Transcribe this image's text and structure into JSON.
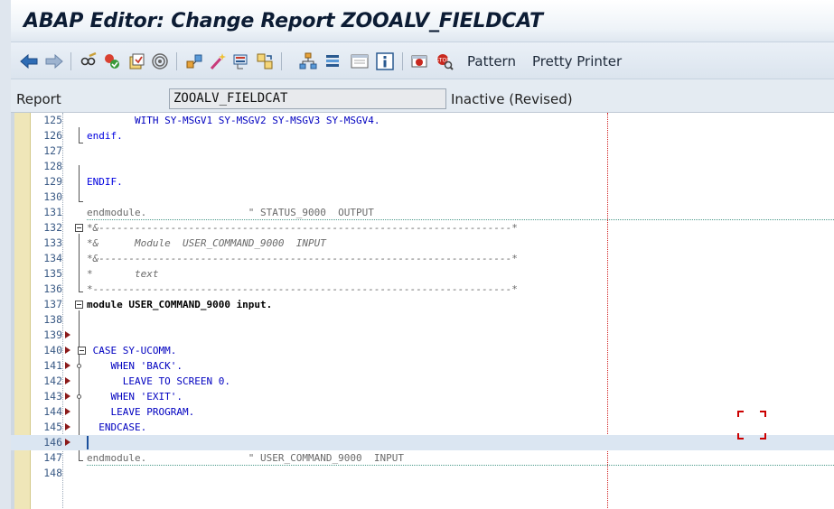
{
  "window": {
    "title": "ABAP Editor: Change Report ZOOALV_FIELDCAT"
  },
  "toolbar": {
    "icons": [
      {
        "name": "back-arrow-icon",
        "color": "#2f6db5"
      },
      {
        "name": "forward-arrow-icon",
        "color": "#8aa6c8"
      },
      {
        "name": "glasses-display-change-icon"
      },
      {
        "name": "activate-check-icon"
      },
      {
        "name": "test-object-icon"
      },
      {
        "name": "where-used-icon"
      },
      {
        "name": "object-list-icon"
      },
      {
        "name": "magic-wand-icon"
      },
      {
        "name": "debug-display-icon"
      },
      {
        "name": "sync-navigation-icon"
      },
      {
        "name": "hierarchy-icon"
      },
      {
        "name": "stack-icon"
      },
      {
        "name": "window-icon"
      },
      {
        "name": "info-icon"
      },
      {
        "name": "breakpoint-session-icon"
      },
      {
        "name": "breakpoint-external-icon"
      }
    ],
    "pattern_label": "Pattern",
    "pretty_printer_label": "Pretty Printer"
  },
  "report": {
    "label": "Report",
    "name": "ZOOALV_FIELDCAT",
    "status": "Inactive (Revised)"
  },
  "editor": {
    "lines": [
      {
        "n": "125",
        "text": "        WITH SY-MSGV1 SY-MSGV2 SY-MSGV3 SY-MSGV4."
      },
      {
        "n": "126",
        "text": "endif."
      },
      {
        "n": "127",
        "text": ""
      },
      {
        "n": "128",
        "text": ""
      },
      {
        "n": "129",
        "text": "ENDIF."
      },
      {
        "n": "130",
        "text": ""
      },
      {
        "n": "131",
        "text": "endmodule.                 \" STATUS_9000  OUTPUT"
      },
      {
        "n": "132",
        "text": "*&---------------------------------------------------------------------*"
      },
      {
        "n": "133",
        "text": "*&      Module  USER_COMMAND_9000  INPUT"
      },
      {
        "n": "134",
        "text": "*&---------------------------------------------------------------------*"
      },
      {
        "n": "135",
        "text": "*       text"
      },
      {
        "n": "136",
        "text": "*----------------------------------------------------------------------*"
      },
      {
        "n": "137",
        "text": "module USER_COMMAND_9000 input."
      },
      {
        "n": "138",
        "text": ""
      },
      {
        "n": "139",
        "text": ""
      },
      {
        "n": "140",
        "text": " CASE SY-UCOMM."
      },
      {
        "n": "141",
        "text": "    WHEN 'BACK'."
      },
      {
        "n": "142",
        "text": "      LEAVE TO SCREEN 0."
      },
      {
        "n": "143",
        "text": "    WHEN 'EXIT'."
      },
      {
        "n": "144",
        "text": "    LEAVE PROGRAM."
      },
      {
        "n": "145",
        "text": "  ENDCASE."
      },
      {
        "n": "146",
        "text": ""
      },
      {
        "n": "147",
        "text": "endmodule.                 \" USER_COMMAND_9000  INPUT"
      },
      {
        "n": "148",
        "text": ""
      }
    ]
  }
}
